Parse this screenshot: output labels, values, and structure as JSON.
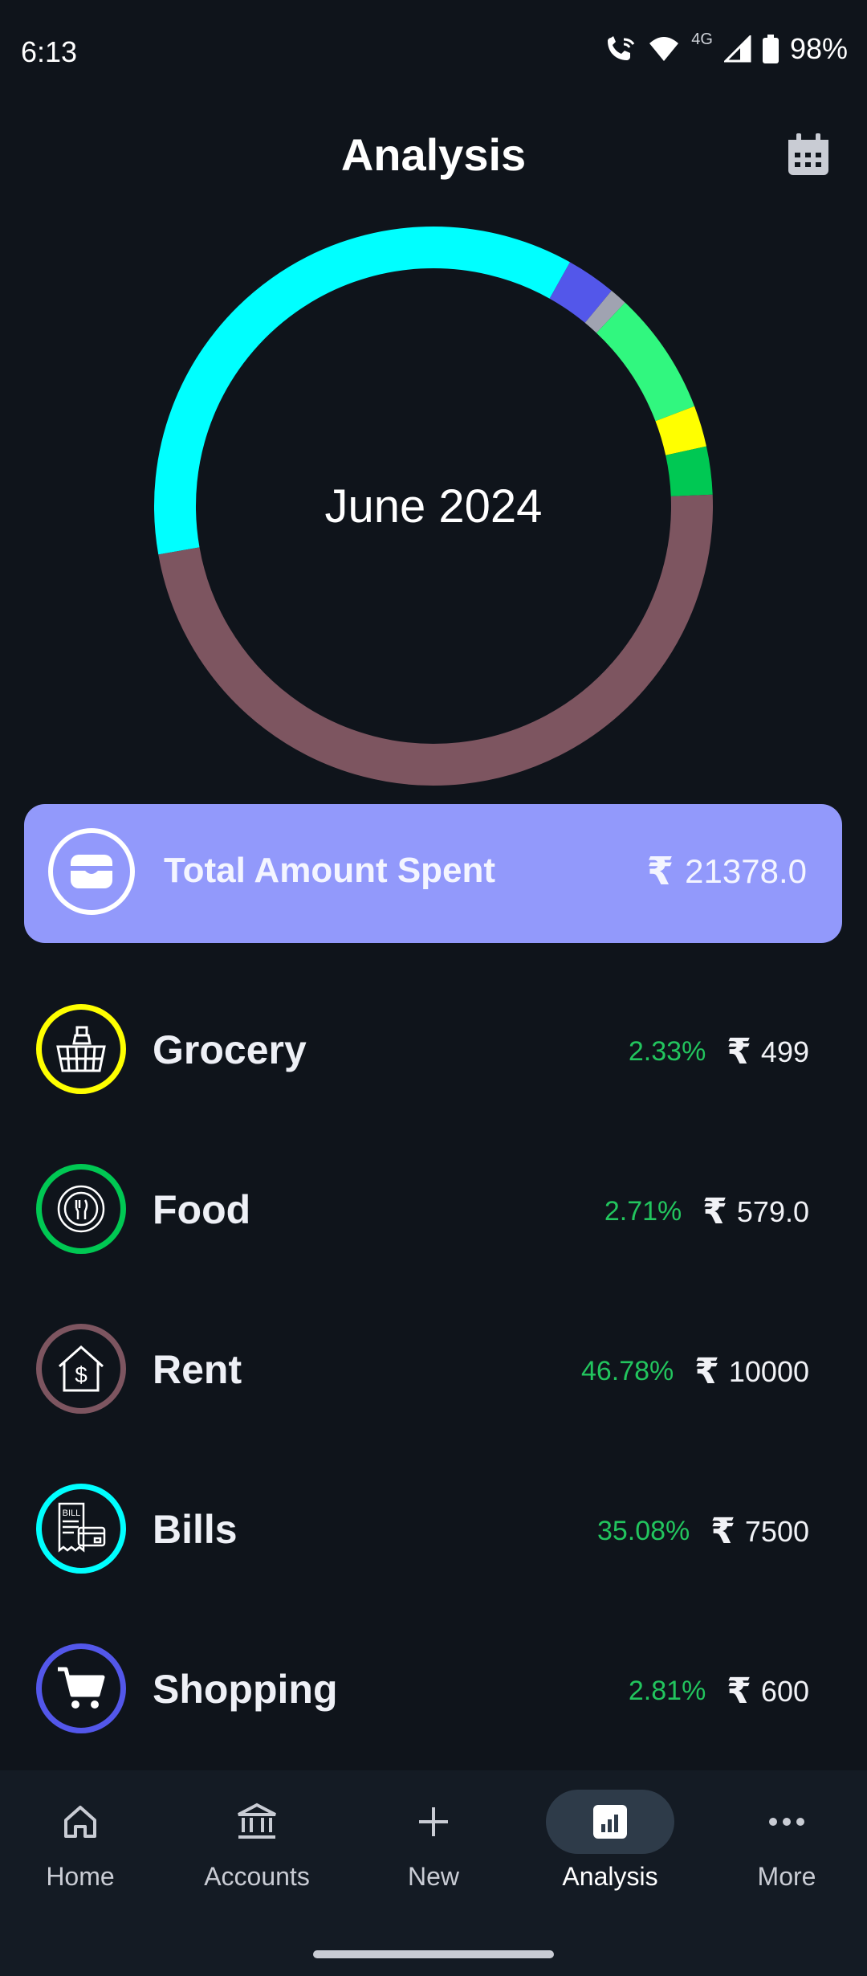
{
  "status_bar": {
    "time": "6:13",
    "network": "4G",
    "battery": "98%"
  },
  "header": {
    "title": "Analysis"
  },
  "chart_data": {
    "type": "pie",
    "title": "June 2024",
    "categories": [
      "Bills",
      "Shopping",
      "Other",
      "Grocery-light",
      "Yellow",
      "Food",
      "Rent"
    ],
    "values": [
      35.08,
      2.81,
      1.0,
      7.0,
      2.33,
      2.71,
      46.78
    ],
    "colors": [
      "#00ffff",
      "#5357ea",
      "#a0a3b1",
      "#31f77f",
      "#ffff00",
      "#00c853",
      "#7d5560"
    ]
  },
  "total": {
    "label": "Total Amount Spent",
    "currency": "₹",
    "amount": "21378.0"
  },
  "categories": [
    {
      "name": "Grocery",
      "percent": "2.33%",
      "currency": "₹",
      "amount": "499",
      "color": "#ffff00",
      "icon": "basket-icon"
    },
    {
      "name": "Food",
      "percent": "2.71%",
      "currency": "₹",
      "amount": "579.0",
      "color": "#00c853",
      "icon": "plate-icon"
    },
    {
      "name": "Rent",
      "percent": "46.78%",
      "currency": "₹",
      "amount": "10000",
      "color": "#7d5560",
      "icon": "house-dollar-icon"
    },
    {
      "name": "Bills",
      "percent": "35.08%",
      "currency": "₹",
      "amount": "7500",
      "color": "#00ffff",
      "icon": "bill-icon"
    },
    {
      "name": "Shopping",
      "percent": "2.81%",
      "currency": "₹",
      "amount": "600",
      "color": "#5357ea",
      "icon": "cart-icon"
    }
  ],
  "nav": [
    {
      "label": "Home",
      "icon": "home-icon"
    },
    {
      "label": "Accounts",
      "icon": "bank-icon"
    },
    {
      "label": "New",
      "icon": "plus-icon"
    },
    {
      "label": "Analysis",
      "icon": "chart-icon",
      "active": true
    },
    {
      "label": "More",
      "icon": "more-icon"
    }
  ]
}
